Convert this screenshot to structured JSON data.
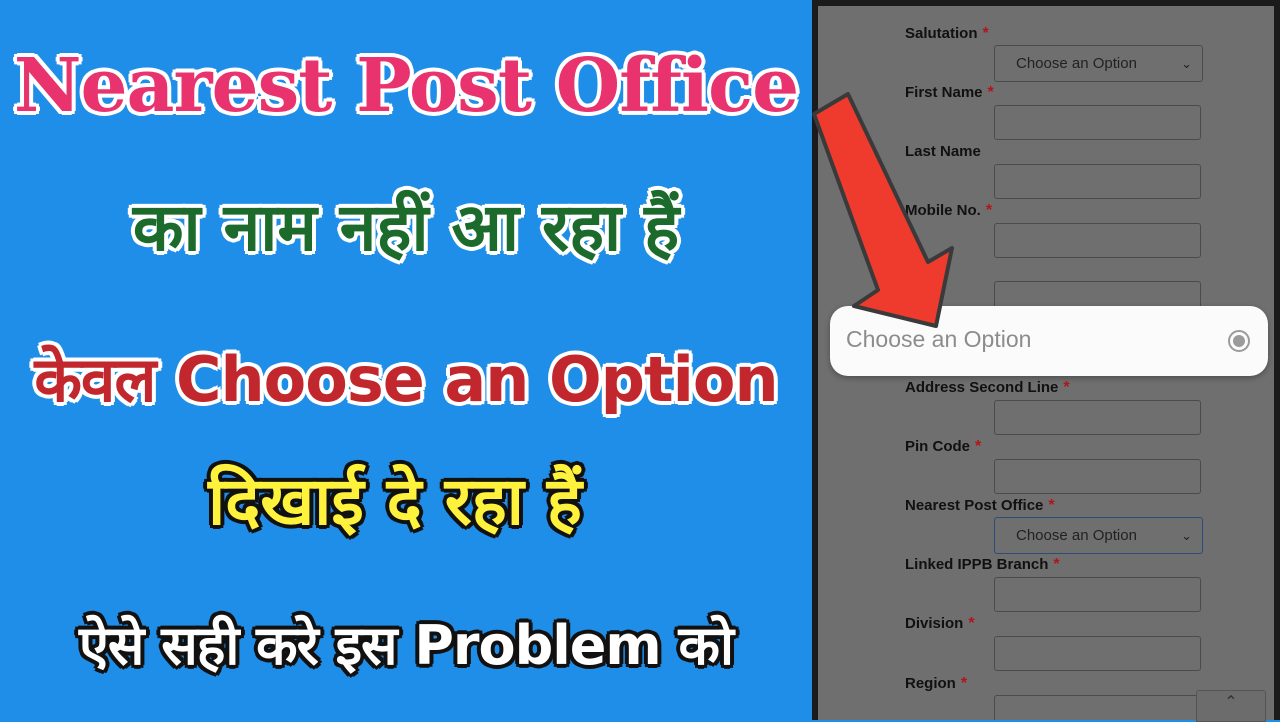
{
  "headline": {
    "line1": "Nearest Post Office",
    "line2": "का नाम नहीं आ रहा हैं",
    "line3": "केवल Choose an Option",
    "line4": "दिखाई दे रहा हैं",
    "line5": "ऐसे सही करे इस Problem को"
  },
  "form": {
    "required_marker": "*",
    "fields": [
      {
        "label": "Salutation",
        "required": true,
        "type": "select",
        "value": "Choose an Option"
      },
      {
        "label": "First Name",
        "required": true,
        "type": "input"
      },
      {
        "label": "Last Name",
        "required": false,
        "type": "input"
      },
      {
        "label": "Mobile No.",
        "required": true,
        "type": "input"
      },
      {
        "label": "Address Second Line",
        "required": true,
        "type": "input"
      },
      {
        "label": "Pin Code",
        "required": true,
        "type": "input"
      },
      {
        "label": "Nearest Post Office",
        "required": true,
        "type": "select",
        "value": "Choose an Option"
      },
      {
        "label": "Linked IPPB Branch",
        "required": true,
        "type": "input"
      },
      {
        "label": "Division",
        "required": true,
        "type": "input"
      },
      {
        "label": "Region",
        "required": true,
        "type": "input"
      }
    ]
  },
  "popup": {
    "option_text": "Choose an Option"
  },
  "colors": {
    "left_bg": "#1f8ee8",
    "line1": "#e8336e",
    "line2": "#1c6a2c",
    "line3": "#c1272d",
    "line4": "#fff23d",
    "line5": "#ffffff",
    "arrow": "#ef3b2d",
    "required": "#b3141b"
  },
  "icons": {
    "arrow": "red-pointer-arrow-icon",
    "dropdown": "chevron-down-icon",
    "radio": "radio-selected-icon",
    "scroll_top": "chevron-up-icon"
  }
}
